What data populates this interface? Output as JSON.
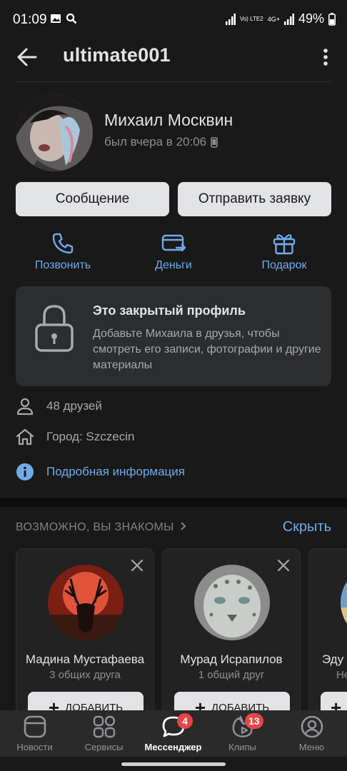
{
  "status_bar": {
    "time": "01:09",
    "network_label": "Vo) LTE2",
    "network_gen": "4G+",
    "battery": "49%"
  },
  "header": {
    "title": "ultimate001"
  },
  "profile": {
    "name": "Михаил Москвин",
    "last_seen": "был вчера в 20:06",
    "message_button": "Сообщение",
    "request_button": "Отправить заявку"
  },
  "actions": [
    {
      "label": "Позвонить",
      "icon": "phone-icon"
    },
    {
      "label": "Деньги",
      "icon": "money-transfer-icon"
    },
    {
      "label": "Подарок",
      "icon": "gift-icon"
    }
  ],
  "closed_profile": {
    "title": "Это закрытый профиль",
    "text": "Добавьте Михаила в друзья, чтобы смотреть его записи, фотографии и другие материалы"
  },
  "info": {
    "friends": "48 друзей",
    "city": "Город: Szczecin",
    "details_link": "Подробная информация"
  },
  "suggestions": {
    "title": "ВОЗМОЖНО, ВЫ ЗНАКОМЫ",
    "hide": "Скрыть",
    "add_label": "ДОБАВИТЬ",
    "people": [
      {
        "name": "Мадина Мустафаева",
        "mutual": "3 общих друга"
      },
      {
        "name": "Мурад Исрапилов",
        "mutual": "1 общий друг"
      },
      {
        "name": "Эду",
        "mutual": "Не"
      }
    ]
  },
  "tabbar": {
    "tabs": [
      {
        "label": "Новости",
        "icon": "news-icon"
      },
      {
        "label": "Сервисы",
        "icon": "services-icon"
      },
      {
        "label": "Мессенджер",
        "icon": "messenger-icon",
        "badge": "4"
      },
      {
        "label": "Клипы",
        "icon": "clips-icon",
        "badge": "13"
      },
      {
        "label": "Меню",
        "icon": "profile-menu-icon"
      }
    ]
  },
  "colors": {
    "background": "#191919",
    "card": "#2c2d2e",
    "accent": "#71aaeb",
    "badge": "#e64646",
    "button": "#e1e3e6"
  }
}
